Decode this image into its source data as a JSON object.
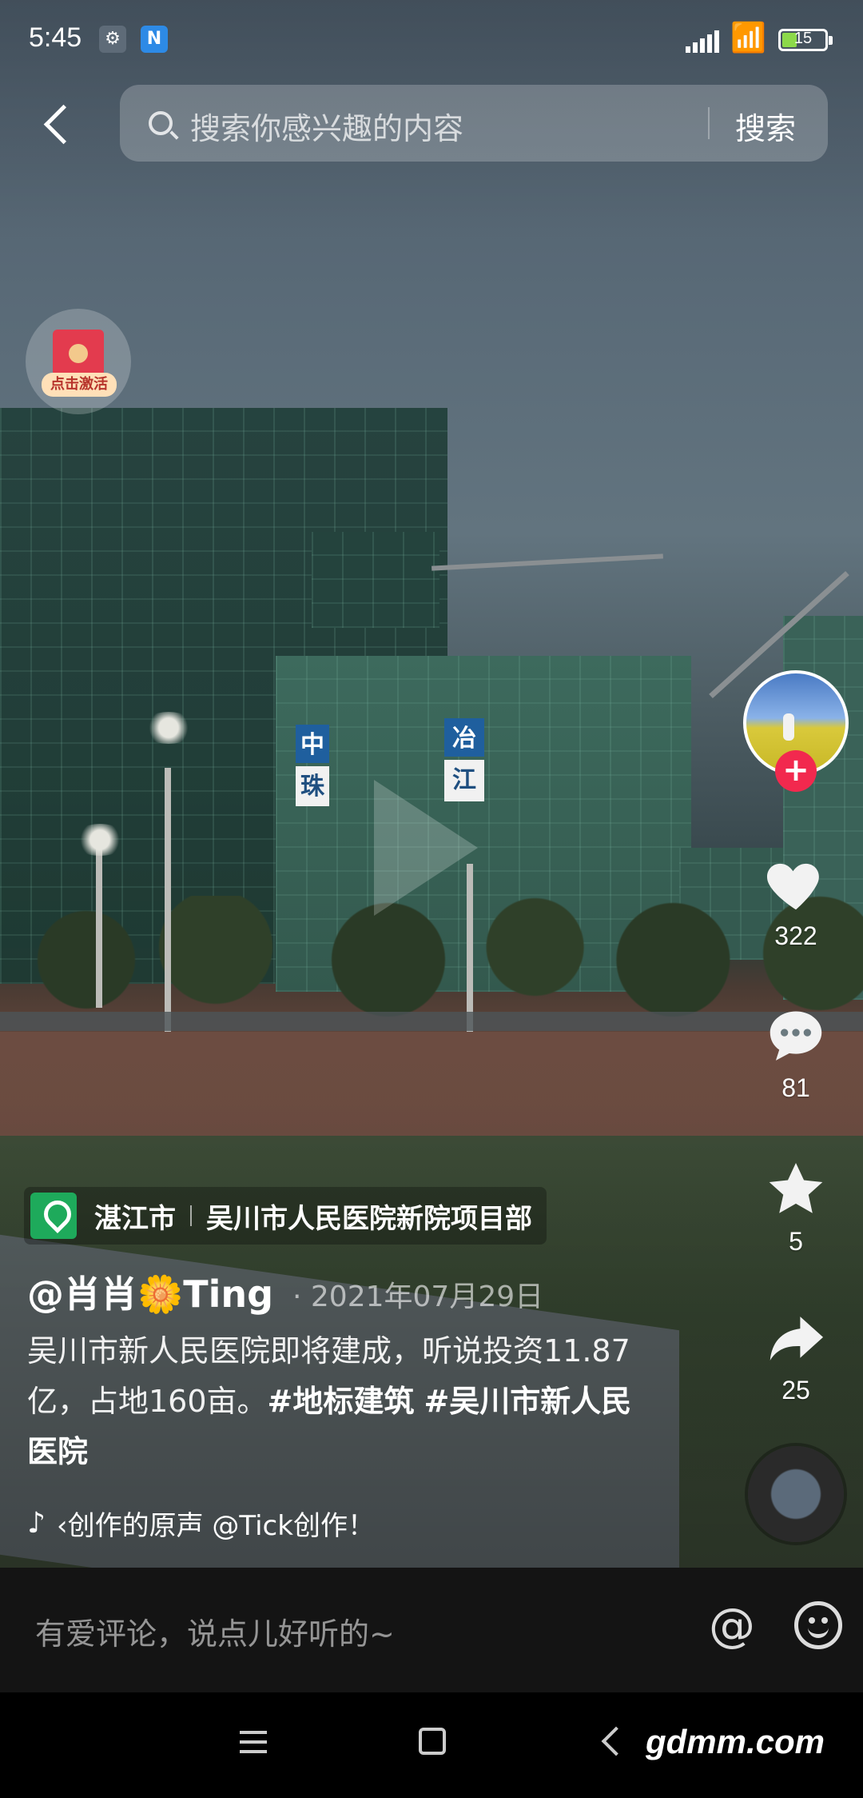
{
  "status_bar": {
    "time": "5:45",
    "battery": "15"
  },
  "search": {
    "placeholder": "搜索你感兴趣的内容",
    "button_label": "搜索"
  },
  "activate_badge": {
    "label": "点击激活"
  },
  "rail": {
    "likes": "322",
    "comments": "81",
    "favorites": "5",
    "shares": "25"
  },
  "location": {
    "city": "湛江市",
    "place": "吴川市人民医院新院项目部"
  },
  "post": {
    "author": "@肖肖🌼Ting",
    "date": "· 2021年07月29日",
    "caption_text": "吴川市新人民医院即将建成，听说投资11.87亿，占地160亩。",
    "hashtag_1": "#地标建筑",
    "hashtag_2": "#吴川市新人民医院"
  },
  "music": {
    "text": "‹创作的原声    @Tick创作！"
  },
  "comment_bar": {
    "placeholder": "有爱评论，说点儿好听的~",
    "at_label": "@"
  },
  "watermark": "gdmm.com",
  "colors": {
    "follow_red": "#f2294e",
    "location_green": "#1eaa5b"
  }
}
